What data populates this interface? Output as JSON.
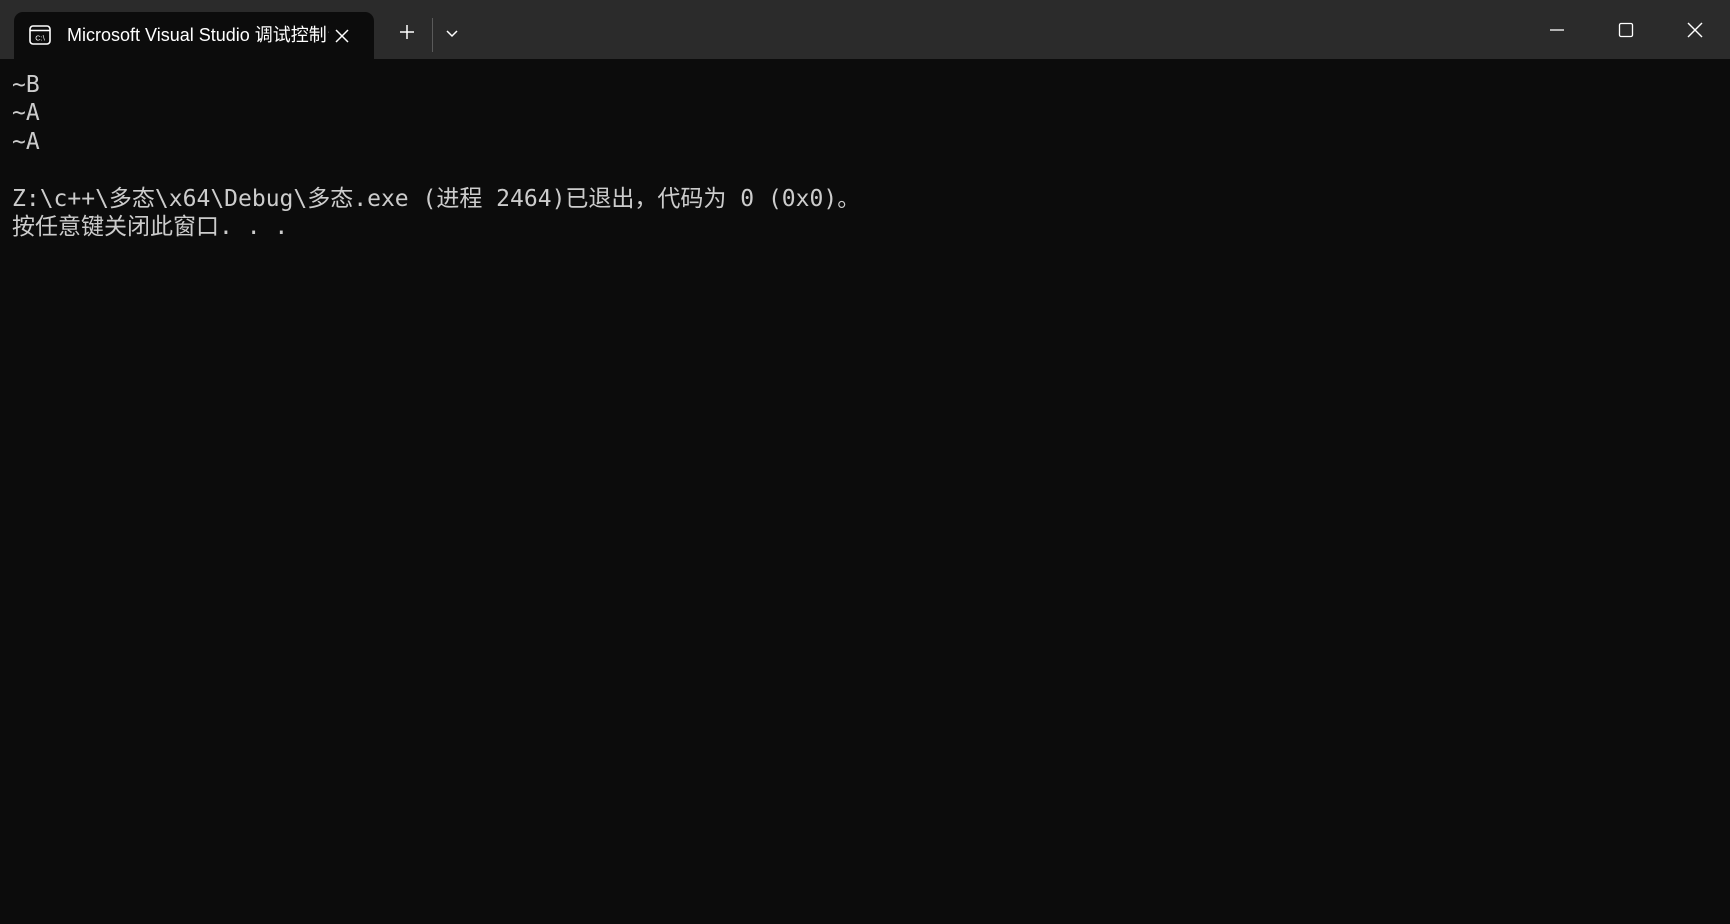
{
  "window": {
    "tab_title": "Microsoft Visual Studio 调试控制台",
    "tab_icon": "console-icon",
    "new_tab_icon": "plus-icon",
    "dropdown_icon": "chevron-down-icon",
    "minimize_icon": "minimize-icon",
    "maximize_icon": "maximize-icon",
    "close_icon": "close-icon"
  },
  "console": {
    "lines": [
      "~B",
      "~A",
      "~A",
      "",
      "Z:\\c++\\多态\\x64\\Debug\\多态.exe (进程 2464)已退出，代码为 0 (0x0)。",
      "按任意键关闭此窗口. . ."
    ]
  },
  "colors": {
    "background": "#0c0c0c",
    "tabbar": "#2b2b2b",
    "text": "#cccccc",
    "title_text": "#ffffff"
  }
}
